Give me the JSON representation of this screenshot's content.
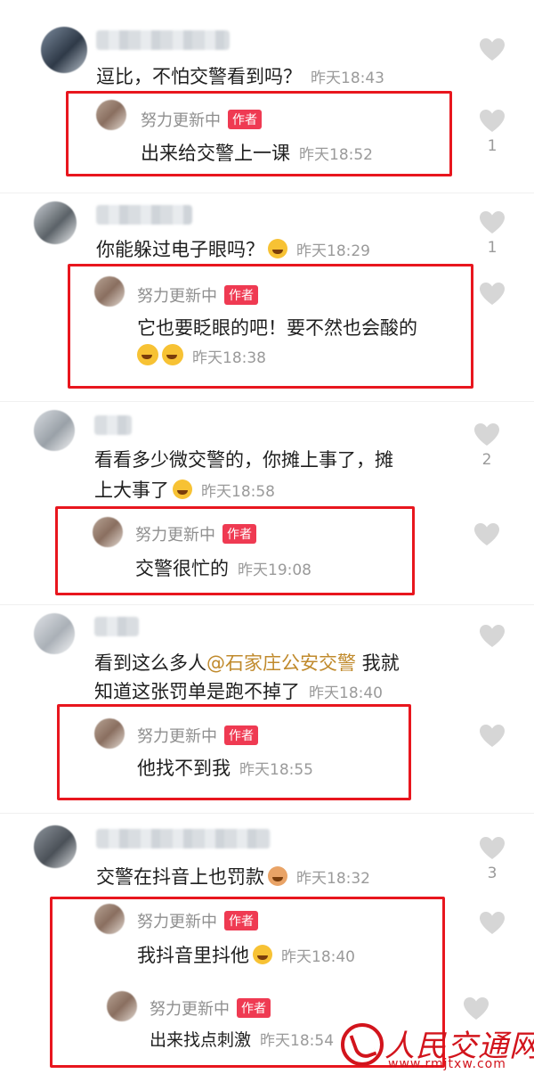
{
  "comments": [
    {
      "text": "逗比，不怕交警看到吗？",
      "time": "昨天18:43",
      "likes": "",
      "reply": {
        "name": "努力更新中",
        "badge": "作者",
        "text": "出来给交警上一课",
        "time": "昨天18:52",
        "likes": "1"
      }
    },
    {
      "text": "你能躲过电子眼吗？",
      "time": "昨天18:29",
      "likes": "1",
      "reply": {
        "name": "努力更新中",
        "badge": "作者",
        "text": "它也要眨眼的吧！要不然也会酸的",
        "time": "昨天18:38",
        "likes": ""
      }
    },
    {
      "text_line1": "看看多少微交警的，你摊上事了，摊",
      "text_line2": "上大事了",
      "time": "昨天18:58",
      "likes": "2",
      "reply": {
        "name": "努力更新中",
        "badge": "作者",
        "text": "交警很忙的",
        "time": "昨天19:08",
        "likes": ""
      }
    },
    {
      "text_pre": "看到这么多人",
      "mention": "@石家庄公安交警",
      "text_post": " 我就",
      "text_line2": "知道这张罚单是跑不掉了",
      "time": "昨天18:40",
      "likes": "",
      "reply": {
        "name": "努力更新中",
        "badge": "作者",
        "text": "他找不到我",
        "time": "昨天18:55",
        "likes": ""
      }
    },
    {
      "text": "交警在抖音上也罚款",
      "time": "昨天18:32",
      "likes": "3",
      "replies": [
        {
          "name": "努力更新中",
          "badge": "作者",
          "text": "我抖音里抖他",
          "time": "昨天18:40"
        },
        {
          "name": "努力更新中",
          "badge": "作者",
          "text": "出来找点刺激",
          "time": "昨天18:54"
        }
      ]
    }
  ],
  "watermark": {
    "text": "人民交通网",
    "url": "www.rmjtxw.com"
  },
  "colors": {
    "highlight_box": "#e8161e",
    "author_badge": "#ef3a52",
    "watermark": "#d2141c"
  },
  "icons": {
    "like": "heart-outline-icon"
  }
}
